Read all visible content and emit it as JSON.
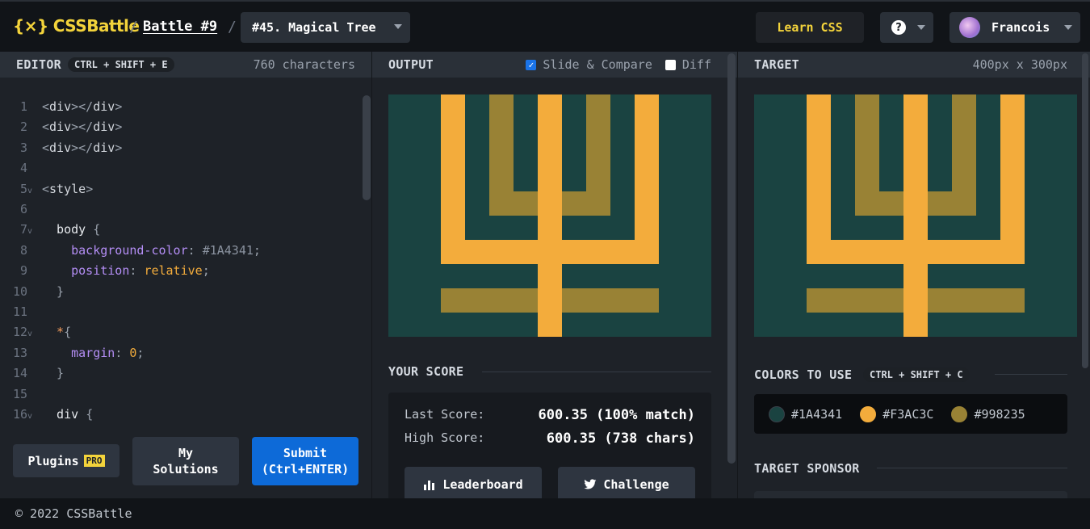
{
  "header": {
    "logo_text": "CSSBattle",
    "logo_icon": "{×}",
    "crumb_sep": "/",
    "battle": "Battle #9",
    "challenge": "#45. Magical Tree",
    "learn_css": "Learn CSS",
    "help_icon": "?",
    "user": "Francois"
  },
  "editor": {
    "title": "EDITOR",
    "shortcut": "CTRL + SHIFT + E",
    "char_count": "760 characters",
    "lines": [
      {
        "n": "1",
        "fold": "",
        "parts": [
          [
            "tok-punct",
            "<"
          ],
          [
            "tok-tag",
            "div"
          ],
          [
            "tok-punct",
            "></"
          ],
          [
            "tok-tag",
            "div"
          ],
          [
            "tok-punct",
            ">"
          ]
        ]
      },
      {
        "n": "2",
        "fold": "",
        "parts": [
          [
            "tok-punct",
            "<"
          ],
          [
            "tok-tag",
            "div"
          ],
          [
            "tok-punct",
            "></"
          ],
          [
            "tok-tag",
            "div"
          ],
          [
            "tok-punct",
            ">"
          ]
        ]
      },
      {
        "n": "3",
        "fold": "",
        "parts": [
          [
            "tok-punct",
            "<"
          ],
          [
            "tok-tag",
            "div"
          ],
          [
            "tok-punct",
            "></"
          ],
          [
            "tok-tag",
            "div"
          ],
          [
            "tok-punct",
            ">"
          ]
        ]
      },
      {
        "n": "4",
        "fold": "",
        "parts": []
      },
      {
        "n": "5",
        "fold": "v",
        "parts": [
          [
            "tok-punct",
            "<"
          ],
          [
            "tok-tag",
            "style"
          ],
          [
            "tok-punct",
            ">"
          ]
        ]
      },
      {
        "n": "6",
        "fold": "",
        "parts": []
      },
      {
        "n": "7",
        "fold": "v",
        "parts": [
          [
            "tok-sel",
            "  body "
          ],
          [
            "tok-punct",
            "{"
          ]
        ]
      },
      {
        "n": "8",
        "fold": "",
        "parts": [
          [
            "tok-prop",
            "    background-color"
          ],
          [
            "tok-punct",
            ": "
          ],
          [
            "tok-hex",
            "#1A4341"
          ],
          [
            "tok-punct",
            ";"
          ]
        ]
      },
      {
        "n": "9",
        "fold": "",
        "parts": [
          [
            "tok-prop",
            "    position"
          ],
          [
            "tok-punct",
            ": "
          ],
          [
            "tok-val",
            "relative"
          ],
          [
            "tok-punct",
            ";"
          ]
        ]
      },
      {
        "n": "10",
        "fold": "",
        "parts": [
          [
            "tok-punct",
            "  }"
          ]
        ]
      },
      {
        "n": "11",
        "fold": "",
        "parts": []
      },
      {
        "n": "12",
        "fold": "v",
        "parts": [
          [
            "tok-star",
            "  *"
          ],
          [
            "tok-punct",
            "{"
          ]
        ]
      },
      {
        "n": "13",
        "fold": "",
        "parts": [
          [
            "tok-prop",
            "    margin"
          ],
          [
            "tok-punct",
            ": "
          ],
          [
            "tok-val",
            "0"
          ],
          [
            "tok-punct",
            ";"
          ]
        ]
      },
      {
        "n": "14",
        "fold": "",
        "parts": [
          [
            "tok-punct",
            "  }"
          ]
        ]
      },
      {
        "n": "15",
        "fold": "",
        "parts": []
      },
      {
        "n": "16",
        "fold": "v",
        "parts": [
          [
            "tok-sel",
            "  div "
          ],
          [
            "tok-punct",
            "{"
          ]
        ]
      }
    ],
    "plugins_label": "Plugins",
    "pro_badge": "PRO",
    "solutions_line1": "My",
    "solutions_line2": "Solutions",
    "submit_line1": "Submit",
    "submit_line2": "(Ctrl+ENTER)"
  },
  "output": {
    "title": "OUTPUT",
    "slide_compare": "Slide & Compare",
    "slide_compare_checked": true,
    "diff": "Diff",
    "diff_checked": false
  },
  "score": {
    "title": "YOUR SCORE",
    "last_label": "Last Score:",
    "last_value": "600.35 (100% match)",
    "high_label": "High Score:",
    "high_value": "600.35 (738 chars)",
    "leaderboard": "Leaderboard",
    "challenge": "Challenge"
  },
  "target": {
    "title": "TARGET",
    "size": "400px x 300px",
    "colors_title": "COLORS TO USE",
    "colors_shortcut": "CTRL + SHIFT + C",
    "colors": [
      "#1A4341",
      "#F3AC3C",
      "#998235"
    ],
    "sponsor_title": "TARGET SPONSOR"
  },
  "footer": {
    "copyright": "© 2022 CSSBattle"
  }
}
